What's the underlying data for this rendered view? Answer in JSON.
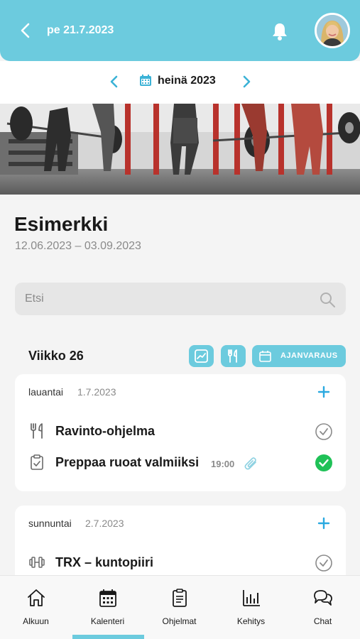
{
  "header": {
    "date": "pe 21.7.2023"
  },
  "month_nav": {
    "label": "heinä 2023"
  },
  "program": {
    "title": "Esimerkki",
    "range": "12.06.2023 – 03.09.2023"
  },
  "search": {
    "placeholder": "Etsi"
  },
  "week": {
    "label": "Viikko 26",
    "booking_label": "AJANVARAUS"
  },
  "days": [
    {
      "name": "lauantai",
      "date": "1.7.2023",
      "items": [
        {
          "title": "Ravinto-ohjelma",
          "icon": "cutlery-icon",
          "done": false
        },
        {
          "title": "Preppaa ruoat valmiiksi",
          "time": "19:00",
          "icon": "clipboard-check-icon",
          "attachment": true,
          "done": true
        }
      ]
    },
    {
      "name": "sunnuntai",
      "date": "2.7.2023",
      "items": [
        {
          "title": "TRX – kuntopiiri",
          "icon": "dumbbell-icon",
          "done": false
        }
      ]
    }
  ],
  "tabs": [
    {
      "label": "Alkuun",
      "icon": "home-icon"
    },
    {
      "label": "Kalenteri",
      "icon": "calendar-icon",
      "active": true
    },
    {
      "label": "Ohjelmat",
      "icon": "clipboard-list-icon"
    },
    {
      "label": "Kehitys",
      "icon": "bar-chart-icon"
    },
    {
      "label": "Chat",
      "icon": "chat-icon"
    }
  ],
  "colors": {
    "accent": "#6ccbde",
    "success": "#1fc157",
    "plus": "#2aa9e0"
  }
}
